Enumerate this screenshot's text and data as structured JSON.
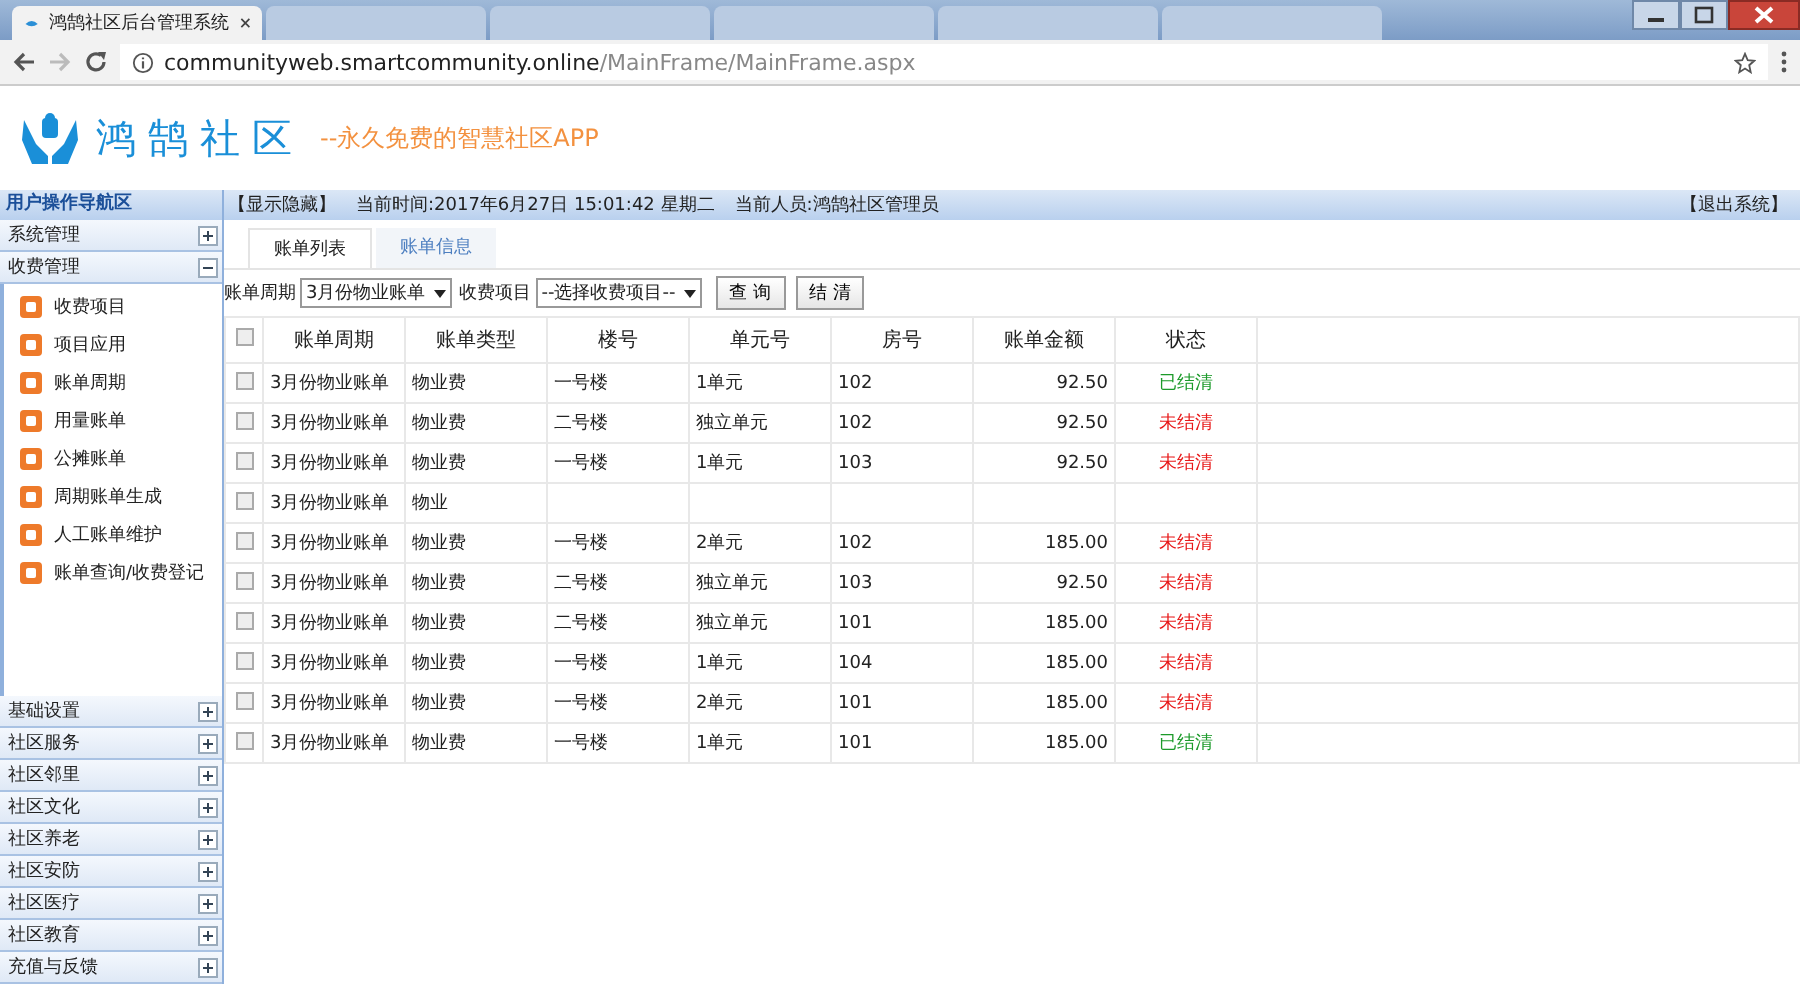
{
  "browser": {
    "tabs": [
      {
        "title": "鸿鹄社区后台管理系统",
        "selected": true
      },
      {
        "selected": false
      },
      {
        "selected": false
      },
      {
        "selected": false
      },
      {
        "selected": false
      },
      {
        "selected": false
      }
    ],
    "url_host": "communityweb.smartcommunity.online",
    "url_path": "/MainFrame/MainFrame.aspx"
  },
  "header": {
    "logo_text": "鸿鹄社区",
    "slogan": "--永久免费的智慧社区APP"
  },
  "sidebar": {
    "title": "用户操作导航区",
    "groups": [
      {
        "label": "系统管理",
        "expanded": false
      },
      {
        "label": "收费管理",
        "expanded": true,
        "children": [
          "收费项目",
          "项目应用",
          "账单周期",
          "用量账单",
          "公摊账单",
          "周期账单生成",
          "人工账单维护",
          "账单查询/收费登记"
        ]
      },
      {
        "label": "基础设置",
        "expanded": false
      },
      {
        "label": "社区服务",
        "expanded": false
      },
      {
        "label": "社区邻里",
        "expanded": false
      },
      {
        "label": "社区文化",
        "expanded": false
      },
      {
        "label": "社区养老",
        "expanded": false
      },
      {
        "label": "社区安防",
        "expanded": false
      },
      {
        "label": "社区医疗",
        "expanded": false
      },
      {
        "label": "社区教育",
        "expanded": false
      },
      {
        "label": "充值与反馈",
        "expanded": false
      }
    ]
  },
  "info_bar": {
    "toggle": "【显示隐藏】",
    "time": "当前时间:2017年6月27日 15:01:42 星期二",
    "user": "当前人员:鸿鹄社区管理员",
    "logout": "【退出系统】"
  },
  "tabs": [
    {
      "label": "账单列表",
      "selected": true
    },
    {
      "label": "账单信息",
      "selected": false
    }
  ],
  "filters": {
    "period_label": "账单周期",
    "period_value": "3月份物业账单",
    "item_label": "收费项目",
    "item_value": "--选择收费项目--",
    "buttons": [
      "查 询",
      "结 清"
    ]
  },
  "table": {
    "select_all_checked": false,
    "columns": [
      "账单周期",
      "账单类型",
      "楼号",
      "单元号",
      "房号",
      "账单金额",
      "状态"
    ],
    "rows": [
      {
        "checked": false,
        "cells": [
          "3月份物业账单",
          "物业费",
          "一号楼",
          "1单元",
          "102",
          "92.50"
        ],
        "status": "已结清",
        "settled": true
      },
      {
        "checked": false,
        "cells": [
          "3月份物业账单",
          "物业费",
          "二号楼",
          "独立单元",
          "102",
          "92.50"
        ],
        "status": "未结清",
        "settled": false
      },
      {
        "checked": false,
        "cells": [
          "3月份物业账单",
          "物业费",
          "一号楼",
          "1单元",
          "103",
          "92.50"
        ],
        "status": "未结清",
        "settled": false
      },
      {
        "checked": false,
        "cells": [
          "3月份物业账单",
          "物业"
        ]
      },
      {
        "checked": false,
        "cells": [
          "3月份物业账单",
          "物业费",
          "一号楼",
          "2单元",
          "102",
          "185.00"
        ],
        "status": "未结清",
        "settled": false
      },
      {
        "checked": false,
        "cells": [
          "3月份物业账单",
          "物业费",
          "二号楼",
          "独立单元",
          "103",
          "92.50"
        ],
        "status": "未结清",
        "settled": false
      },
      {
        "checked": false,
        "cells": [
          "3月份物业账单",
          "物业费",
          "二号楼",
          "独立单元",
          "101",
          "185.00"
        ],
        "status": "未结清",
        "settled": false
      },
      {
        "checked": false,
        "cells": [
          "3月份物业账单",
          "物业费",
          "一号楼",
          "1单元",
          "104",
          "185.00"
        ],
        "status": "未结清",
        "settled": false
      },
      {
        "checked": false,
        "cells": [
          "3月份物业账单",
          "物业费",
          "一号楼",
          "2单元",
          "101",
          "185.00"
        ],
        "status": "未结清",
        "settled": false
      },
      {
        "checked": false,
        "cells": [
          "3月份物业账单",
          "物业费",
          "一号楼",
          "1单元",
          "101",
          "185.00"
        ],
        "status": "已结清",
        "settled": true
      }
    ]
  }
}
